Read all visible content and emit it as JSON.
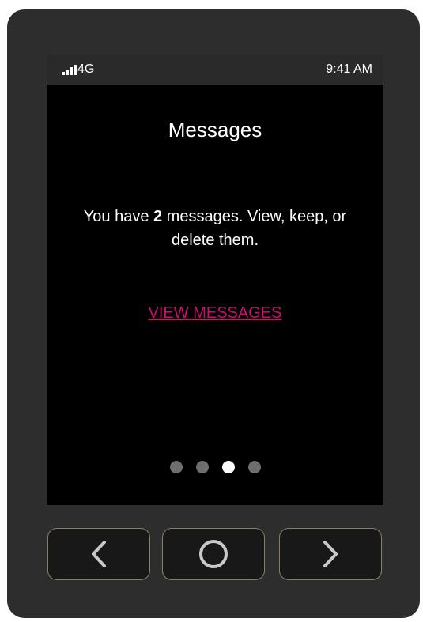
{
  "status_bar": {
    "network": "4G",
    "time": "9:41 AM",
    "signal_icon": "signal-bars-icon"
  },
  "screen": {
    "title": "Messages",
    "message_prefix": "You have ",
    "message_count": "2",
    "message_suffix": " messages. View, keep, or delete them.",
    "link_label": "VIEW MESSAGES",
    "pagination": {
      "total_pages": 4,
      "active_page": 3
    }
  },
  "hardware_buttons": [
    {
      "name": "back",
      "icon": "chevron-left-icon"
    },
    {
      "name": "home",
      "icon": "circle-icon"
    },
    {
      "name": "next",
      "icon": "chevron-right-icon"
    }
  ],
  "colors": {
    "link": "#c8106e",
    "screen_bg": "#000000",
    "bezel": "#2d2d2d",
    "button_border": "#8a7f62",
    "dot_inactive": "#6e6e6e",
    "dot_active": "#ffffff"
  }
}
